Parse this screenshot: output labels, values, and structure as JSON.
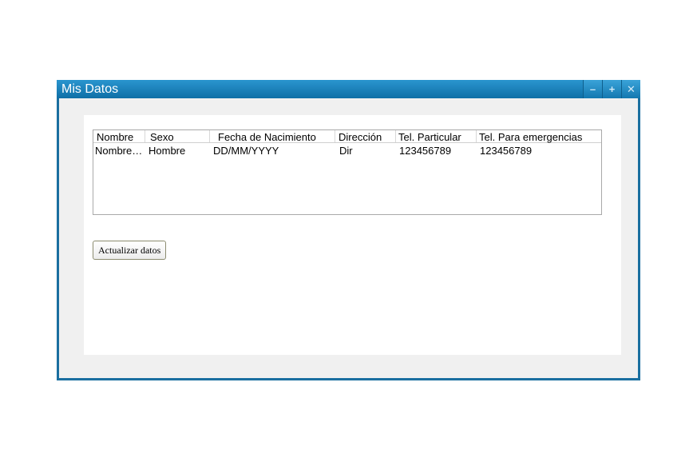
{
  "window": {
    "title": "Mis Datos",
    "controls": {
      "minimize": "–",
      "maximize": "+",
      "close": "✕"
    }
  },
  "table": {
    "columns": [
      "Nombre",
      "Sexo",
      "Fecha de Nacimiento",
      "Dirección",
      "Tel. Particular",
      "Tel. Para emergencias"
    ],
    "rows": [
      [
        "Nombre…",
        "Hombre",
        "DD/MM/YYYY",
        "Dir",
        "123456789",
        "123456789"
      ]
    ]
  },
  "actions": {
    "update_label": "Actualizar datos"
  },
  "colors": {
    "titlebar": "#1a7fb8",
    "border": "#1a6fa0",
    "panel": "#f0f0f0"
  }
}
